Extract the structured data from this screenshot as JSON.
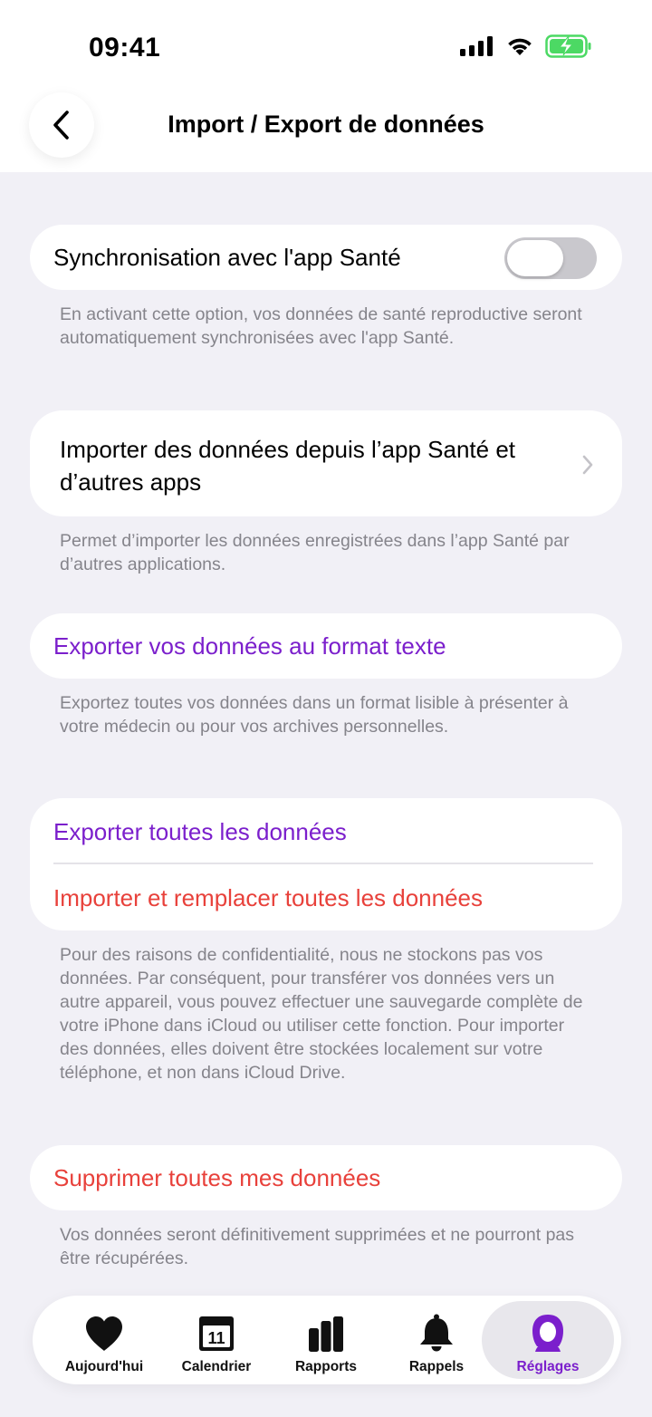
{
  "status_bar": {
    "time": "09:41"
  },
  "header": {
    "title": "Import / Export de données"
  },
  "sections": {
    "health_sync": {
      "label": "Synchronisation avec l'app Santé",
      "enabled": false,
      "note": "En activant cette option, vos données de santé reproductive seront automatiquement synchronisées avec l'app Santé."
    },
    "import_health": {
      "label": "Importer des données depuis l’app Santé et d’autres apps",
      "note": "Permet d’importer les données enregistrées dans l’app Santé par d’autres applications."
    },
    "export_text": {
      "label": "Exporter vos données au format texte",
      "note": "Exportez toutes vos données dans un format lisible à présenter à votre médecin ou pour vos archives personnelles."
    },
    "backup": {
      "export_label": "Exporter toutes les données",
      "import_label": "Importer et remplacer toutes les données",
      "note": "Pour des raisons de confidentialité, nous ne stockons pas vos données. Par conséquent, pour transférer vos données vers un autre appareil, vous pouvez effectuer une sauvegarde complète de votre iPhone dans iCloud ou utiliser cette fonction. Pour importer des données, elles doivent être stockées localement sur votre téléphone, et non dans iCloud Drive."
    },
    "delete": {
      "label": "Supprimer toutes mes données",
      "note": "Vos données seront définitivement supprimées et ne pourront pas être récupérées."
    }
  },
  "tabbar": {
    "tabs": [
      {
        "label": "Aujourd'hui",
        "icon": "heart-icon"
      },
      {
        "label": "Calendrier",
        "icon": "calendar-icon",
        "icon_text": "11"
      },
      {
        "label": "Rapports",
        "icon": "bar-chart-icon"
      },
      {
        "label": "Rappels",
        "icon": "bell-icon"
      },
      {
        "label": "Réglages",
        "icon": "person-icon",
        "active": true
      }
    ]
  },
  "colors": {
    "accent": "#7b1fcc",
    "destructive": "#e8413b",
    "background": "#f1f0f6",
    "battery": "#4cd964"
  }
}
